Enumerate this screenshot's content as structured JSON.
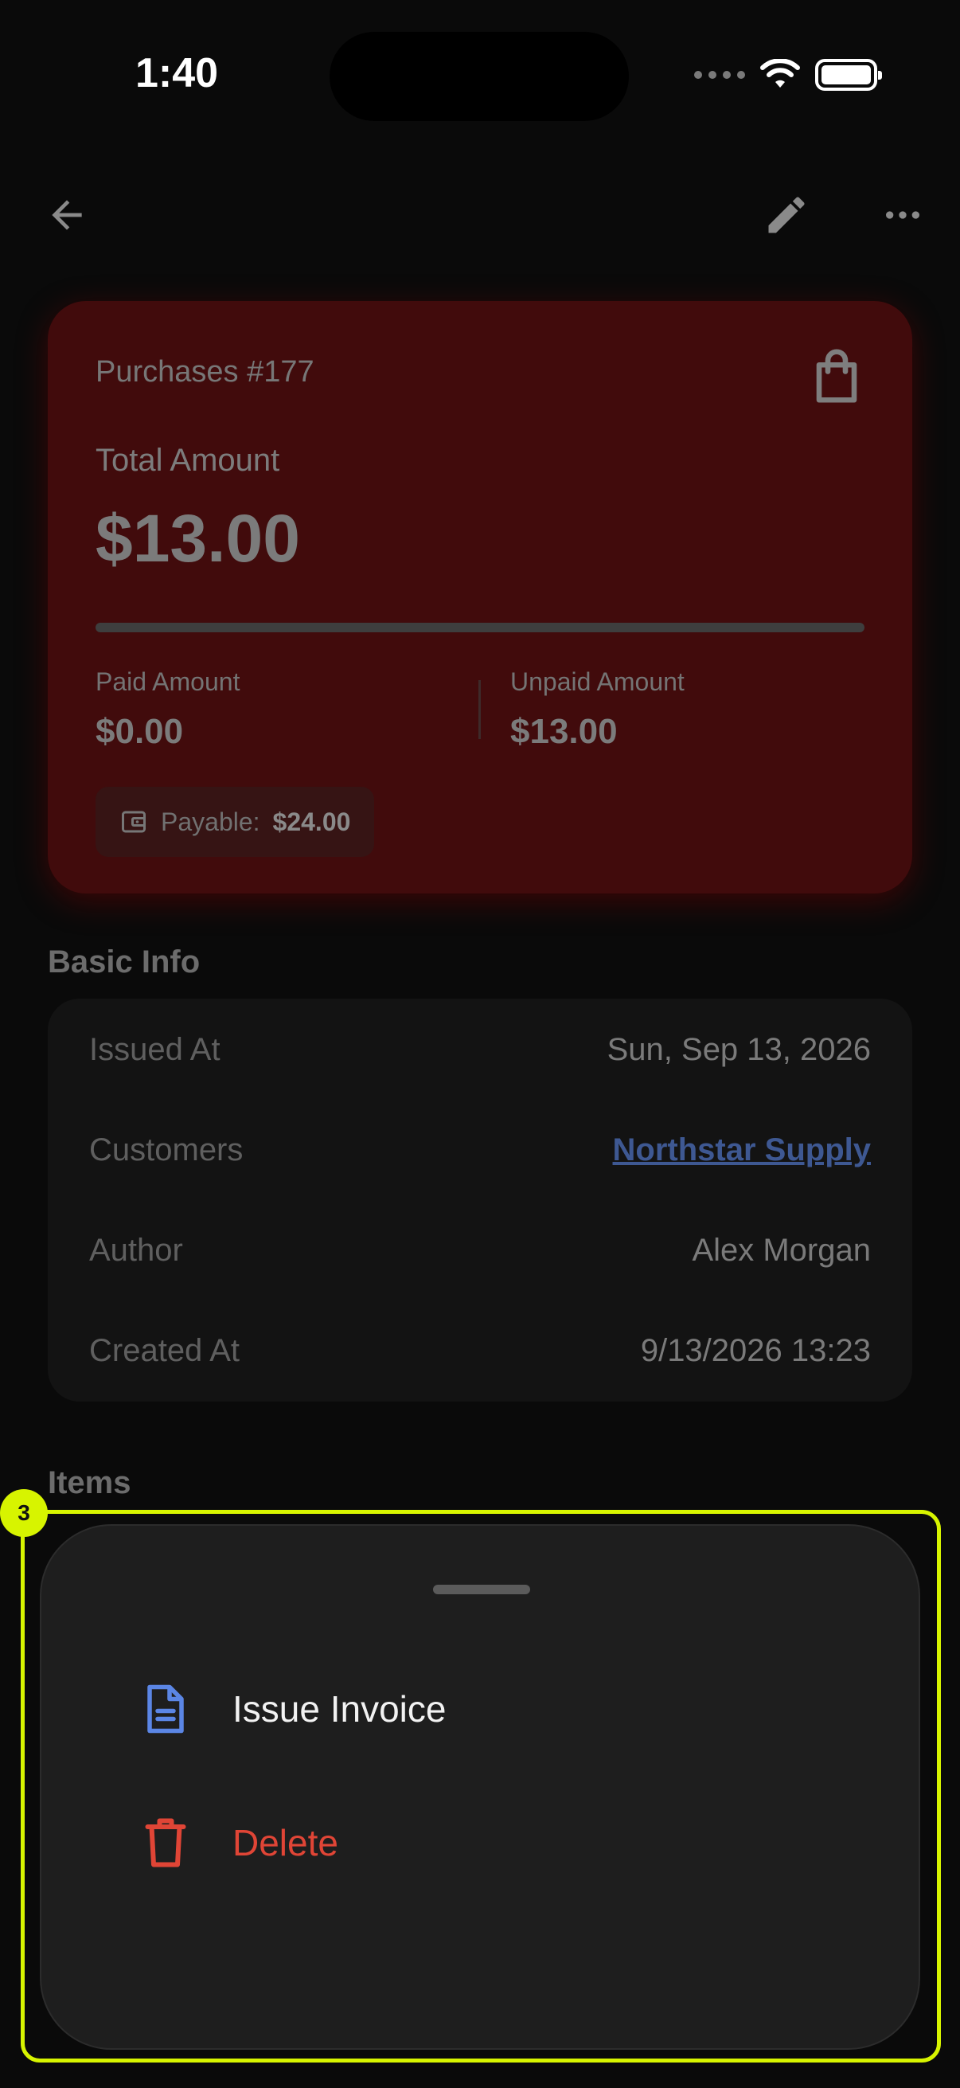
{
  "status_bar": {
    "time": "1:40"
  },
  "summary": {
    "title": "Purchases #177",
    "total_label": "Total Amount",
    "total_value": "$13.00",
    "paid_label": "Paid Amount",
    "paid_value": "$0.00",
    "unpaid_label": "Unpaid Amount",
    "unpaid_value": "$13.00",
    "payable_label": "Payable:",
    "payable_value": "$24.00",
    "paid_progress": 0
  },
  "basic_info": {
    "title": "Basic Info",
    "rows": [
      {
        "label": "Issued At",
        "value": "Sun, Sep 13, 2026"
      },
      {
        "label": "Customers",
        "value": "Northstar Supply"
      },
      {
        "label": "Author",
        "value": "Alex Morgan"
      },
      {
        "label": "Created At",
        "value": "9/13/2026 13:23"
      }
    ]
  },
  "items_section": {
    "title": "Items"
  },
  "sheet": {
    "items": [
      {
        "label": "Issue Invoice",
        "icon": "document-icon",
        "color": "#5b86e5"
      },
      {
        "label": "Delete",
        "icon": "trash-icon",
        "color": "#e04536"
      }
    ]
  },
  "annotation": {
    "badge": "3",
    "color": "#d7f400"
  }
}
